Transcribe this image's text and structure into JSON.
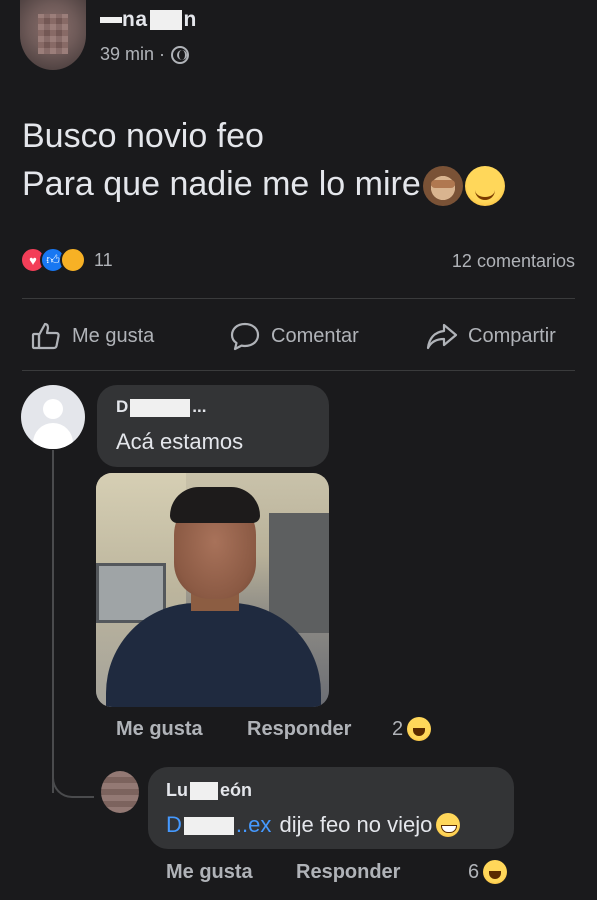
{
  "post": {
    "author_prefix": "na",
    "author_suffix": "n",
    "time": "39 min ·",
    "text": "Busco novio feo\nPara que nadie me lo mire",
    "reaction_count": "11",
    "comments_count": "12 comentarios"
  },
  "actions": {
    "like": "Me gusta",
    "comment": "Comentar",
    "share": "Compartir"
  },
  "comments": [
    {
      "name_visible": "D",
      "name_tail": "...",
      "text": "Acá estamos",
      "like_label": "Me gusta",
      "reply_label": "Responder",
      "reaction_count": "2"
    },
    {
      "name_prefix": "Lu",
      "name_suffix": "eón",
      "mention_prefix": "D",
      "mention_suffix": "..ex",
      "text": " dije feo no viejo",
      "like_label": "Me gusta",
      "reply_label": "Responder",
      "reaction_count": "6"
    }
  ],
  "icons": [
    "globe-icon",
    "heart-react-icon",
    "like-react-icon",
    "care-react-icon",
    "like-icon",
    "comment-icon",
    "share-icon",
    "laugh-icon",
    "grin-icon",
    "monkey-icon",
    "smile-icon"
  ]
}
